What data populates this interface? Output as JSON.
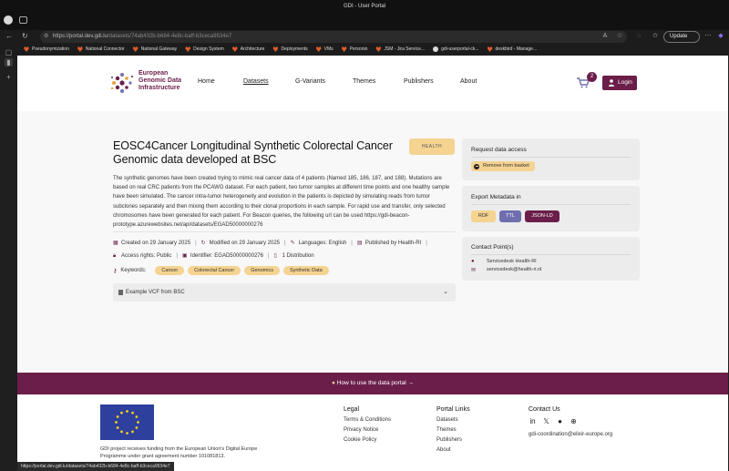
{
  "browser": {
    "tab_title": "GDI - User Portal",
    "url_host": "https://portal.dev.gdi.lu",
    "url_path": "/datasets/74ab432b-b684-4e8c-baff-b3ceca9534e7",
    "update_label": "Update",
    "bookmarks": [
      "Pseudonymization",
      "National Connector",
      "National Gateway",
      "Design System",
      "Architecture",
      "Deployments",
      "VMs",
      "Personio",
      "JSM - Jira Service...",
      "gdi-userportal-ck...",
      "deskbird - Manage..."
    ],
    "status_url": "https://portal.dev.gdi.lu/datasets/74ab432b-b684-4e8c-baff-b3ceca9534e7"
  },
  "header": {
    "logo_lines": [
      "European",
      "Genomic Data",
      "Infrastructure"
    ],
    "nav": [
      "Home",
      "Datasets",
      "G-Variants",
      "Themes",
      "Publishers",
      "About"
    ],
    "cart_count": "2",
    "login_label": "Login"
  },
  "dataset": {
    "title": "EOSC4Cancer Longitudinal Synthetic Colorectal Cancer Genomic data developed at BSC",
    "theme_badge": "HEALTH",
    "description": "The synthetic genomes have been created trying to mimic real cancer data of 4 patients (Named 185, 186, 187, and 188). Mutations are based on real CRC patients from the PCAWG dataset. For each patient, two tumor samples at different time points and one healthy sample have been simulated. The cancer intra-tumor heterogeneity and evolution in the patients is depicted by simulating reads from tumor subclones separately and then mixing them according to their clonal proportions in each sample. For rapid use and transfer, only selected chromosomes have been generated for each patient. For Beacon queries, the following url can be used https://gdi-beacon-prototype.azurewebsites.net/api/datasets/EGAD50000000276",
    "created": "Created on 29 January 2025",
    "modified": "Modified on 29 January 2025",
    "languages": "Languages: English",
    "publisher": "Published by Health-RI",
    "access": "Access rights: Public",
    "identifier": "Identifier: EGAD50000000276",
    "distributions": "1 Distribution",
    "keywords_label": "Keywords:",
    "keywords": [
      "Cancer",
      "Colorectal Cancer",
      "Genomics",
      "Synthetic Data"
    ],
    "accordion_label": "Example VCF from BSC"
  },
  "sidebar": {
    "request_title": "Request data access",
    "remove_label": "Remove from basket",
    "export_title": "Export Metadata in",
    "formats": [
      "RDF",
      "TTL",
      "JSON-LD"
    ],
    "contact_title": "Contact Point(s)",
    "contact_name": "Servicedesk Health-RI",
    "contact_email": "servicedesk@health-ri.nl"
  },
  "howto_label": "How to use the data portal",
  "footer": {
    "funding": "GDI project receives funding from the European Union's Digital Europe Programme under grant agreement number 101081813.",
    "legal_title": "Legal",
    "legal_links": [
      "Terms & Conditions",
      "Privacy Notice",
      "Cookie Policy"
    ],
    "portal_title": "Portal Links",
    "portal_links": [
      "Datasets",
      "Themes",
      "Publishers",
      "About"
    ],
    "contact_title": "Contact Us",
    "contact_email": "gdi-coordination@elixir-europe.org"
  },
  "colors": {
    "brand": "#6b1e49",
    "chip": "#f5d391",
    "ttl": "#6f6fb0"
  }
}
